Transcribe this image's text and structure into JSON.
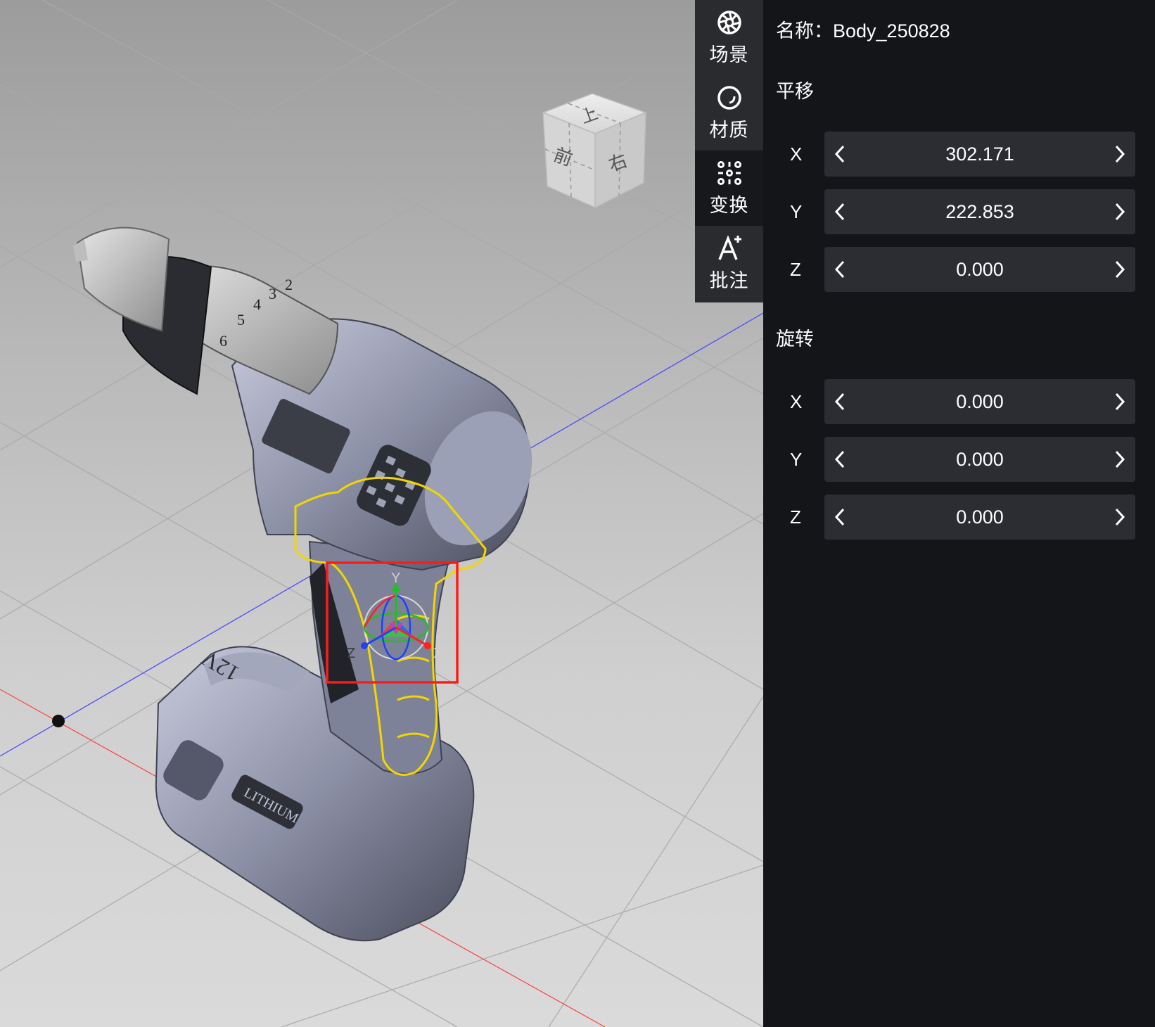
{
  "viewport": {
    "view_cube": {
      "top": "上",
      "front": "前",
      "right": "右"
    },
    "gizmo": {
      "y_label": "Y",
      "z_label": "Z",
      "x_label": "X"
    },
    "battery": {
      "voltage_label": "12V",
      "brand_label": "LITHIUM"
    },
    "chuck_numbers": [
      "2",
      "3",
      "4",
      "5",
      "6"
    ]
  },
  "toolbar": {
    "items": [
      {
        "label": "场景",
        "icon": "aperture-icon",
        "active": false
      },
      {
        "label": "材质",
        "icon": "circle-icon",
        "active": false
      },
      {
        "label": "变换",
        "icon": "transform-grid-icon",
        "active": true
      },
      {
        "label": "批注",
        "icon": "annotate-icon",
        "active": false
      }
    ]
  },
  "panel": {
    "name_label": "名称：",
    "name_value": "Body_250828",
    "translate": {
      "title": "平移",
      "x_label": "X",
      "x_value": "302.171",
      "y_label": "Y",
      "y_value": "222.853",
      "z_label": "Z",
      "z_value": "0.000"
    },
    "rotate": {
      "title": "旋转",
      "x_label": "X",
      "x_value": "0.000",
      "y_label": "Y",
      "y_value": "0.000",
      "z_label": "Z",
      "z_value": "0.000"
    }
  },
  "colors": {
    "panel_bg": "#141519",
    "field_bg": "#2b2d32",
    "selection_outline": "#f2d600",
    "selection_box": "#ff1a1a",
    "drill_body": "#8a8ea5"
  }
}
